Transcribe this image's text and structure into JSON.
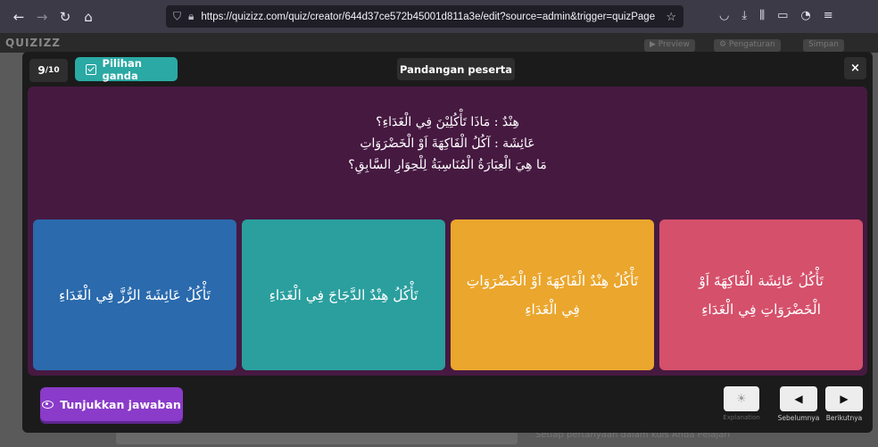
{
  "browser": {
    "url": "https://quizizz.com/quiz/creator/644d37ce572b45001d811a3e/edit?source=admin&trigger=quizPage"
  },
  "background": {
    "logo": "QUIZIZZ",
    "preview_label": "▶ Preview",
    "settings_label": "⚙ Pengaturan",
    "save_label": "Simpan",
    "footer_hint": "Setiap pertanyaan dalam kuis Anda Pelajari"
  },
  "modal": {
    "counter_current": "9",
    "counter_total": "/10",
    "question_type": "Pilihan ganda",
    "view_mode": "Pandangan peserta",
    "close": "×"
  },
  "question": {
    "lines": [
      "هِنْدٌ : مَاذَا تَأْكُلِيْنَ فِي الْغَدَاءِ؟",
      "عَائِشَة : آكُلُ الْفَاكِهَةَ اَوْ الْخَضْرَوَاتِ",
      "مَا هِيَ الْعِبَارَةُ الْمُنَاسِبَةُ لِلْحِوَارِ السَّابِقِ؟"
    ]
  },
  "options": [
    {
      "text": "تَأْكُلُ عَائِشَةَ الرُّزَّ فِي الْغَدَاءِ",
      "color": "#2a6aad"
    },
    {
      "text": "تَأْكُلُ هِنْدٌ الدَّجَاجَ فِي الْغَدَاءِ",
      "color": "#2a9f9e"
    },
    {
      "text": "تَأْكُلُ هِنْدٌ الْفَاكِهَةَ اَوْ الْخَضْرَوَاتِ فِي الْغَدَاءِ",
      "color": "#eba62d"
    },
    {
      "text": "تَأْكُلُ عَائِشَة الْفَاكِهَةَ اَوْ الْخَضْرَوَاتِ فِي الْغَدَاءِ",
      "color": "#d5506b"
    }
  ],
  "footer": {
    "show_answer": "Tunjukkan jawaban",
    "explanation": "Explanation",
    "previous": "Sebelumnya",
    "next": "Berikutnya"
  },
  "icons": [
    "back-arrow-icon",
    "forward-arrow-icon",
    "reload-icon",
    "home-icon",
    "shield-icon",
    "lock-icon",
    "star-icon",
    "pocket-icon",
    "download-icon",
    "library-icon",
    "sidebar-icon",
    "account-icon",
    "menu-icon",
    "checkbox-icon",
    "eye-icon",
    "lightbulb-icon",
    "chevron-left-icon",
    "chevron-right-icon"
  ]
}
